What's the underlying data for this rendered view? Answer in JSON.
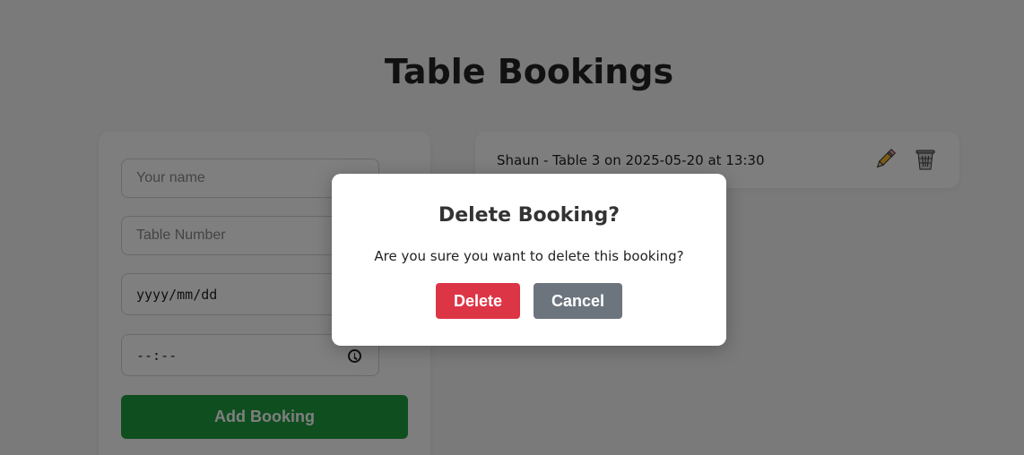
{
  "page": {
    "title": "Table Bookings"
  },
  "form": {
    "name_placeholder": "Your name",
    "table_placeholder": "Table Number",
    "date_placeholder": "yyyy/mm/dd",
    "time_placeholder": "--:--",
    "submit_label": "Add Booking"
  },
  "bookings": [
    {
      "text": "Shaun - Table 3 on 2025-05-20 at 13:30",
      "edit_icon": "pencil-icon",
      "delete_icon": "trash-icon"
    }
  ],
  "modal": {
    "title": "Delete Booking?",
    "message": "Are you sure you want to delete this booking?",
    "confirm_label": "Delete",
    "cancel_label": "Cancel"
  },
  "colors": {
    "primary_green": "#1f9d3f",
    "danger": "#dc3545",
    "secondary": "#6c757d"
  }
}
